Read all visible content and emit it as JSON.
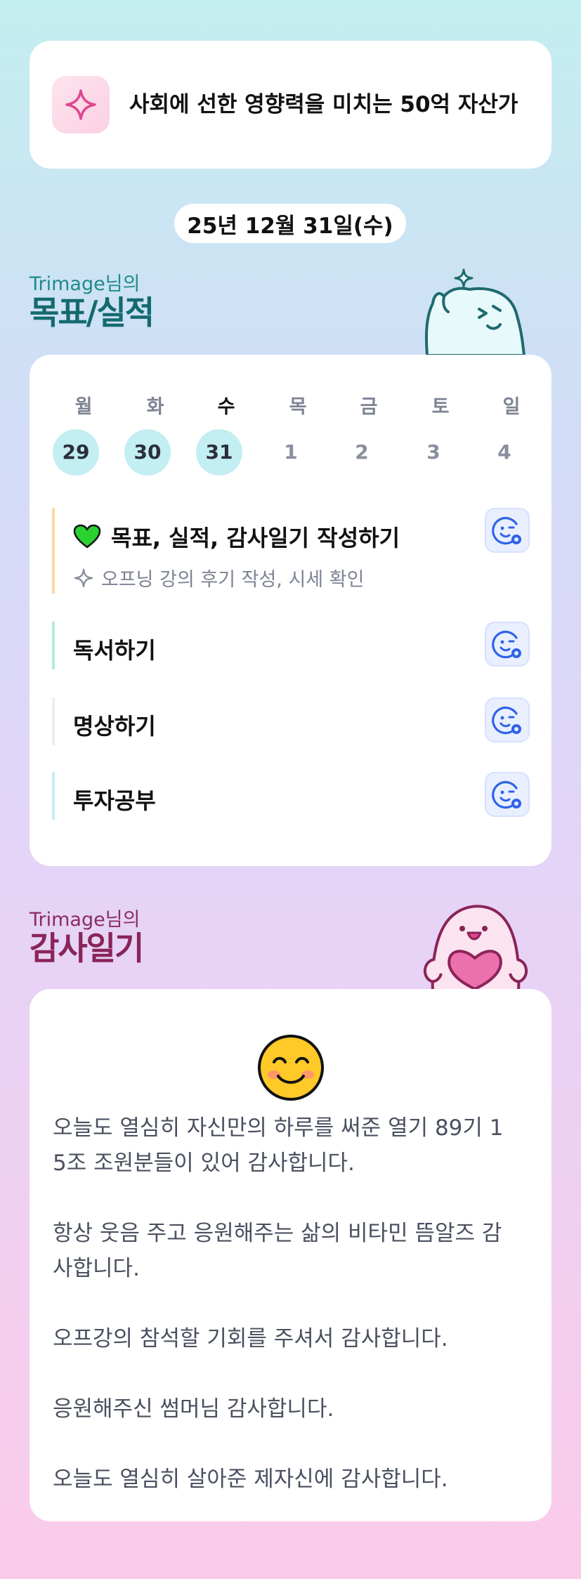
{
  "goal": {
    "text": "사회에 선한 영향력을 미치는 50억 자산가"
  },
  "date": "25년 12월 31일(수)",
  "goals_section": {
    "owner": "Trimage님의",
    "title": "목표/실적"
  },
  "week": {
    "days": [
      {
        "name": "월",
        "num": "29",
        "done": true
      },
      {
        "name": "화",
        "num": "30",
        "done": true
      },
      {
        "name": "수",
        "num": "31",
        "done": true,
        "today": true
      },
      {
        "name": "목",
        "num": "1",
        "done": false
      },
      {
        "name": "금",
        "num": "2",
        "done": false
      },
      {
        "name": "토",
        "num": "3",
        "done": false
      },
      {
        "name": "일",
        "num": "4",
        "done": false
      }
    ]
  },
  "tasks": [
    {
      "title": "목표, 실적, 감사일기 작성하기",
      "sub": "오프닝 강의 후기 작성, 시세 확인",
      "bar_color": "#fcd7a4",
      "has_heart": true
    },
    {
      "title": "독서하기",
      "bar_color": "#b3ecd9"
    },
    {
      "title": "명상하기",
      "bar_color": "#eeeeee"
    },
    {
      "title": "투자공부",
      "bar_color": "#c3eef5"
    }
  ],
  "diary_section": {
    "owner": "Trimage님의",
    "title": "감사일기"
  },
  "diary": {
    "text": "오늘도 열심히 자신만의 하루를 써준 열기 89기 1\n5조 조원분들이 있어 감사합니다.\n\n항상 웃음 주고 응원해주는 삶의 비타민 뜸알즈 감\n사합니다.\n\n오프강의 참석할 기회를 주셔서 감사합니다.\n\n응원해주신 썸머님 감사합니다.\n\n오늘도 열심히 살아준 제자신에 감사합니다."
  },
  "colors": {
    "accent_teal": "#146a6e",
    "accent_plum": "#8a2458",
    "done_day": "#c3eef2",
    "emoji_button": "#e9efff"
  },
  "icons": {
    "goal": "sparkle-icon",
    "task_heart": "green-heart-icon",
    "task_sub": "sparkle-outline-icon",
    "task_button": "smiley-add-icon",
    "diary_mood": "smiling-face-emoji"
  }
}
